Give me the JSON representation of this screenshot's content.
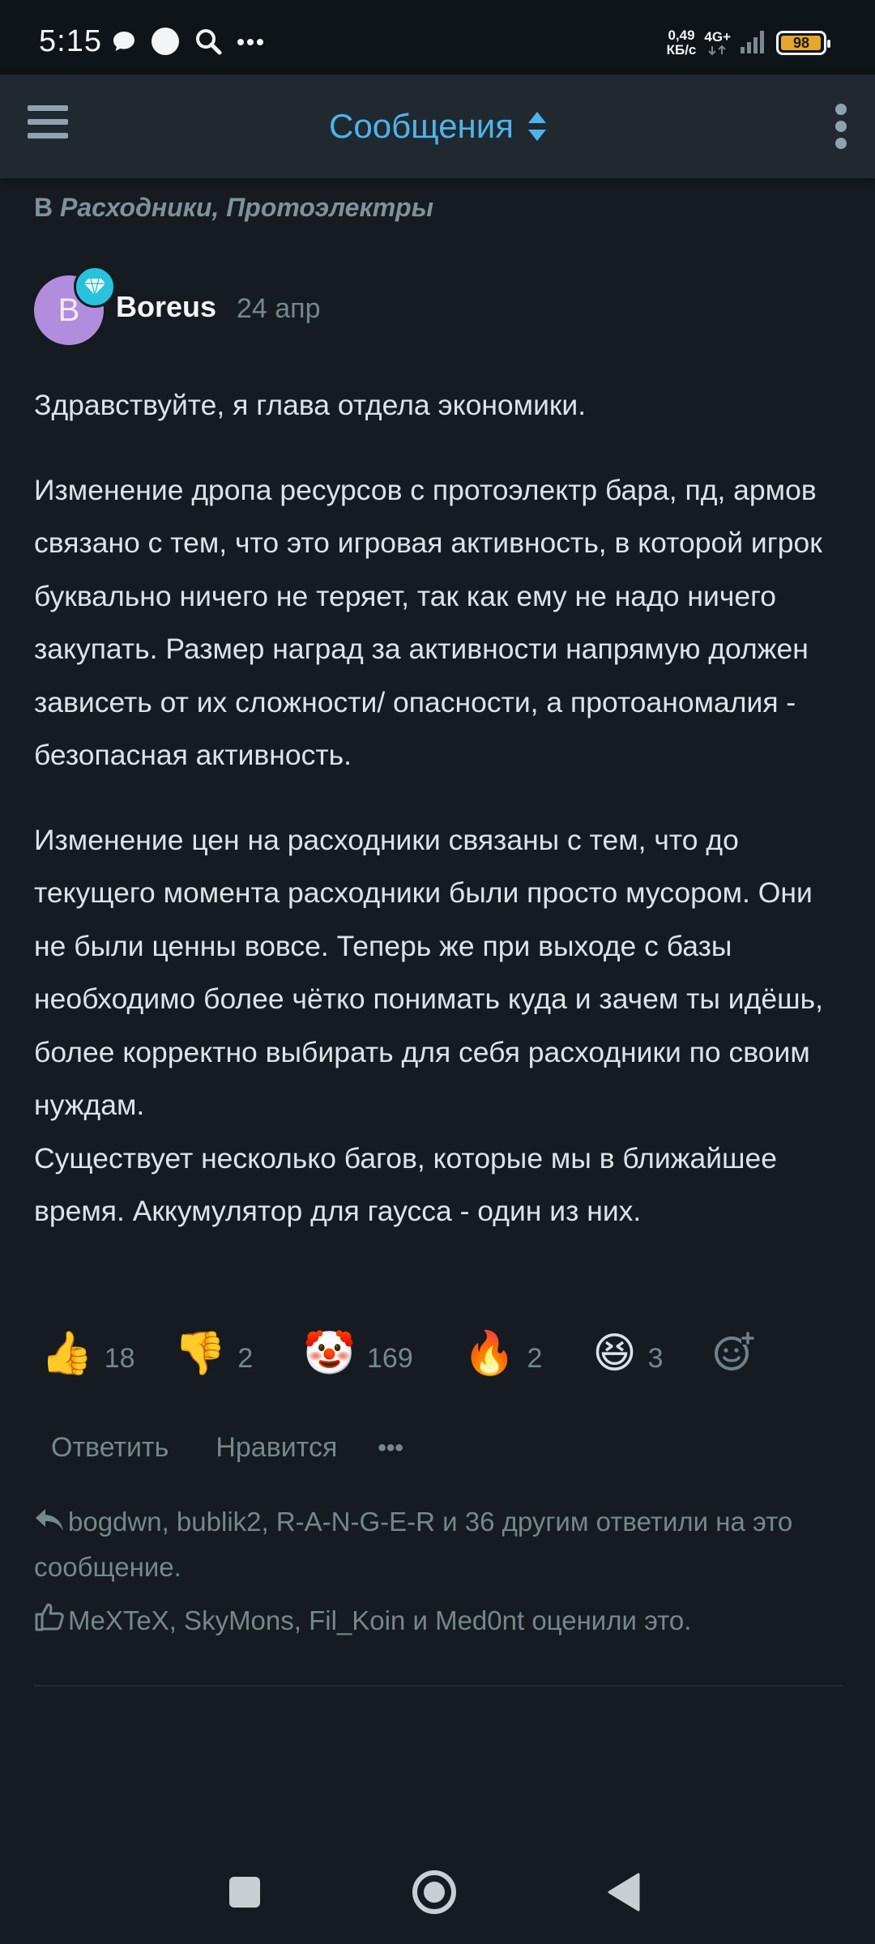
{
  "status_bar": {
    "time": "5:15",
    "network_speed_value": "0,49",
    "network_speed_unit": "КБ/с",
    "network_type": "4G+",
    "battery": "98"
  },
  "app_bar": {
    "title": "Сообщения"
  },
  "post": {
    "context_prefix": "В",
    "context_forums": "Расходники, Протоэлектры",
    "author_initial": "B",
    "author": "Boreus",
    "date": "24 апр",
    "paragraphs": [
      "Здравствуйте, я глава отдела экономики.",
      "Изменение дропа ресурсов с протоэлектр бара, пд, армов связано с тем, что это игровая активность, в которой игрок буквально ничего не теряет, так как ему не надо ничего закупать. Размер наград за активности напрямую должен зависеть от их сложности/ опасности, а протоаномалия - безопасная активность.",
      "Изменение цен на расходники связаны с тем, что до текущего момента расходники были просто мусором. Они не были ценны вовсе. Теперь же при выходе с базы необходимо более чётко понимать куда и зачем ты идёшь, более корректно выбирать для себя расходники по своим нуждам.",
      "Существует несколько багов, которые мы в ближайшее время. Аккумулятор для гаусса - один из них."
    ],
    "reactions": [
      {
        "icon": "thumbs-up-icon",
        "emoji": "👍",
        "count": "18"
      },
      {
        "icon": "thumbs-down-icon",
        "emoji": "👎",
        "count": "2"
      },
      {
        "icon": "clown-face-icon",
        "emoji": "🤡",
        "count": "169"
      },
      {
        "icon": "fire-icon",
        "emoji": "🔥",
        "count": "2"
      },
      {
        "icon": "laughing-face-icon",
        "emoji": "😆",
        "count": "3"
      }
    ],
    "actions": {
      "reply": "Ответить",
      "like": "Нравится",
      "more": "•••"
    },
    "replies_text": "bogdwn, bublik2, R-A-N-G-E-R и 36 другим ответили на это сообщение.",
    "likes_text": "MeXTeX, SkyMons, Fil_Koin и Med0nt оценили это."
  },
  "colors": {
    "background": "#151b20",
    "app_bar": "#1f292f",
    "accent": "#4fb3ea",
    "muted_text": "#75878f",
    "badge": "#29c1dc",
    "avatar": "#b28ddd"
  }
}
